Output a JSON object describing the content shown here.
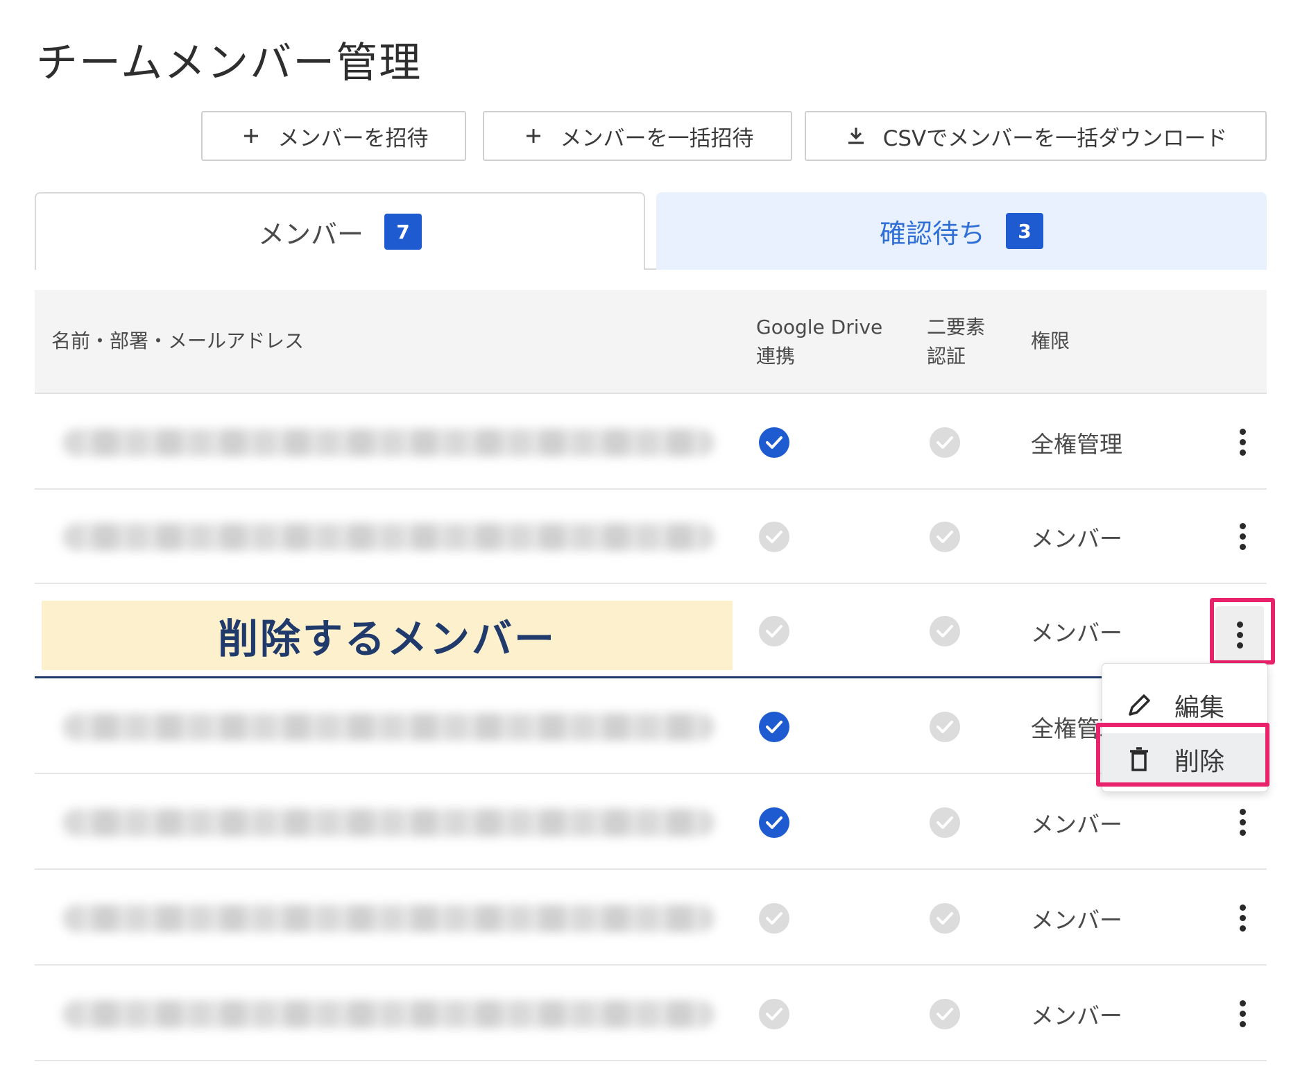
{
  "page": {
    "title": "チームメンバー管理"
  },
  "toolbar": {
    "invite_label": "メンバーを招待",
    "bulk_invite_label": "メンバーを一括招待",
    "csv_download_label": "CSVでメンバーを一括ダウンロード"
  },
  "tabs": [
    {
      "label": "メンバー",
      "count": "7",
      "active": true
    },
    {
      "label": "確認待ち",
      "count": "3",
      "active": false
    }
  ],
  "table": {
    "headers": {
      "name": "名前・部署・メールアドレス",
      "drive_line1": "Google Drive",
      "drive_line2": "連携",
      "twofa_line1": "二要素",
      "twofa_line2": "認証",
      "role": "権限"
    },
    "rows": [
      {
        "drive": true,
        "twofa": false,
        "role": "全権管理"
      },
      {
        "drive": false,
        "twofa": false,
        "role": "メンバー"
      },
      {
        "drive": false,
        "twofa": false,
        "role": "メンバー"
      },
      {
        "drive": true,
        "twofa": false,
        "role": "全権管理"
      },
      {
        "drive": true,
        "twofa": false,
        "role": "メンバー"
      },
      {
        "drive": false,
        "twofa": false,
        "role": "メンバー"
      },
      {
        "drive": false,
        "twofa": false,
        "role": "メンバー"
      }
    ]
  },
  "annotation": {
    "delete_member_label": "削除するメンバー"
  },
  "context_menu": {
    "edit_label": "編集",
    "delete_label": "削除"
  },
  "colors": {
    "accent": "#1e5bd0",
    "highlight": "#e8236b",
    "annotation_bg": "#fdf1cd",
    "annotation_text": "#1f3a6b"
  }
}
